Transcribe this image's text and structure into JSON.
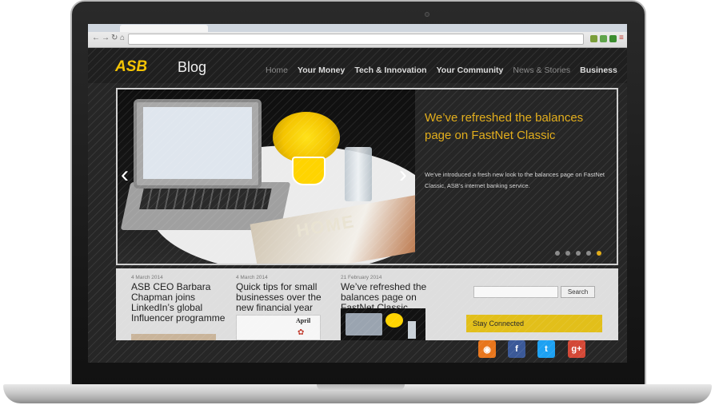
{
  "site": {
    "logo": "ASB",
    "logo_suffix": "Blog",
    "nav": [
      {
        "label": "Home",
        "active": false
      },
      {
        "label": "Your Money",
        "active": true
      },
      {
        "label": "Tech & Innovation",
        "active": true
      },
      {
        "label": "Your Community",
        "active": true
      },
      {
        "label": "News & Stories",
        "active": false
      },
      {
        "label": "Business",
        "active": true
      }
    ]
  },
  "hero": {
    "title": "We’ve refreshed the balances page on FastNet Classic",
    "description": "We’ve introduced a fresh new look to the balances page on FastNet Classic, ASB’s internet banking service.",
    "magazine_text": "HOME",
    "slides": 5,
    "active_slide": 5,
    "prev_icon": "chevron-left-icon",
    "next_icon": "chevron-right-icon"
  },
  "posts": [
    {
      "date": "4 March 2014",
      "title": "ASB CEO Barbara Chapman joins LinkedIn’s global Influencer programme"
    },
    {
      "date": "4 March 2014",
      "title": "Quick tips for small businesses over the new financial year",
      "image_text": "April"
    },
    {
      "date": "21 February 2014",
      "title": "We’ve refreshed the balances page on FastNet Classic"
    }
  ],
  "sidebar": {
    "search_placeholder": "",
    "search_button": "Search",
    "stay_connected": "Stay Connected",
    "social": [
      {
        "icon": "rss-icon",
        "glyph": "◉",
        "color": "#e8761c"
      },
      {
        "icon": "facebook-icon",
        "glyph": "f",
        "color": "#3b5998"
      },
      {
        "icon": "twitter-icon",
        "glyph": "t",
        "color": "#1da1f2"
      },
      {
        "icon": "google-plus-icon",
        "glyph": "g+",
        "color": "#d34836"
      }
    ]
  },
  "colors": {
    "accent": "#e2ad1a",
    "brand": "#f4c300"
  }
}
